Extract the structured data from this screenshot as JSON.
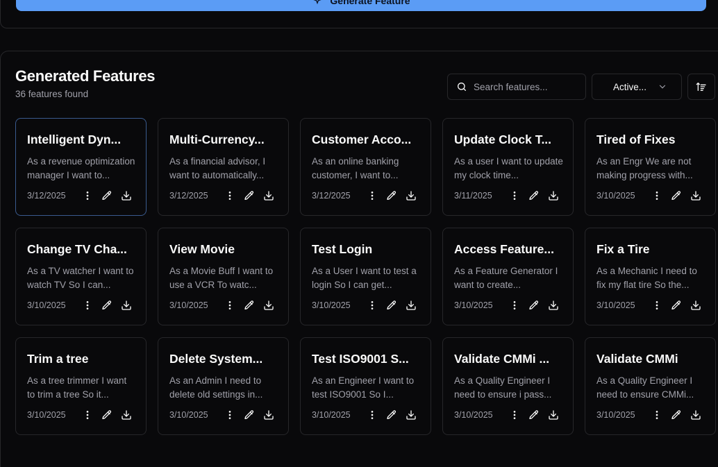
{
  "generate": {
    "label": "Generate Feature"
  },
  "header": {
    "title": "Generated Features",
    "count": "36 features found"
  },
  "search": {
    "placeholder": "Search features...",
    "value": ""
  },
  "filter": {
    "selected": "Active..."
  },
  "features": [
    {
      "title": "Intelligent Dyn...",
      "desc": "As a revenue optimization manager I want to...",
      "date": "3/12/2025"
    },
    {
      "title": "Multi-Currency...",
      "desc": "As a financial advisor, I want to automatically...",
      "date": "3/12/2025"
    },
    {
      "title": "Customer Acco...",
      "desc": "As an online banking customer, I want to...",
      "date": "3/12/2025"
    },
    {
      "title": "Update Clock T...",
      "desc": "As a user I want to update my clock time...",
      "date": "3/11/2025"
    },
    {
      "title": "Tired of Fixes",
      "desc": "As an Engr We are not making progress with...",
      "date": "3/10/2025"
    },
    {
      "title": "Change TV Cha...",
      "desc": "As a TV watcher I want to watch TV So I can...",
      "date": "3/10/2025"
    },
    {
      "title": "View Movie",
      "desc": "As a Movie Buff I want to use a VCR To watc...",
      "date": "3/10/2025"
    },
    {
      "title": "Test Login",
      "desc": "As a User I want to test a login So I can get...",
      "date": "3/10/2025"
    },
    {
      "title": "Access Feature...",
      "desc": "As a Feature Generator I want to create...",
      "date": "3/10/2025"
    },
    {
      "title": "Fix a Tire",
      "desc": "As a Mechanic I need to fix my flat tire So the...",
      "date": "3/10/2025"
    },
    {
      "title": "Trim a tree",
      "desc": "As a tree trimmer I want to trim a tree So it...",
      "date": "3/10/2025"
    },
    {
      "title": "Delete System...",
      "desc": "As an Admin I need to delete old settings in...",
      "date": "3/10/2025"
    },
    {
      "title": "Test ISO9001 S...",
      "desc": "As an Engineer I want to test ISO9001 So I...",
      "date": "3/10/2025"
    },
    {
      "title": "Validate CMMi ...",
      "desc": "As a Quality Engineer I need to ensure i pass...",
      "date": "3/10/2025"
    },
    {
      "title": "Validate CMMi",
      "desc": "As a Quality Engineer I need to ensure CMMi...",
      "date": "3/10/2025"
    }
  ],
  "icons": {
    "search": "search-icon",
    "chevron": "chevron-down-icon",
    "sort": "sort-icon",
    "more": "more-vertical-icon",
    "edit": "pencil-icon",
    "download": "download-icon"
  },
  "colors": {
    "background": "#09090b",
    "border": "#27272a",
    "accent": "#5b9cf5",
    "muted_text": "#a1a1aa",
    "selected_border": "#3b5b8f"
  }
}
